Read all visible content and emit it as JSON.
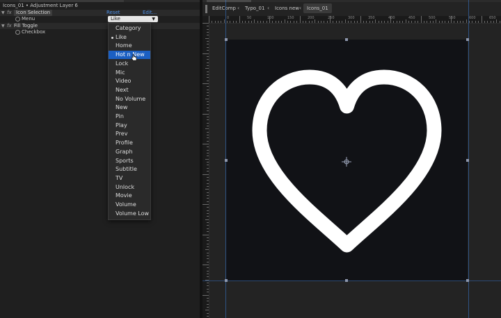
{
  "effect_panel": {
    "title": "Icons_01 • Adjustment Layer 6",
    "effects": [
      {
        "name": "Icon Selection",
        "reset": "Reset",
        "edit": "Edit...",
        "props": [
          {
            "label": "Menu",
            "value": "Like"
          }
        ]
      },
      {
        "name": "Fill Toggle",
        "props": [
          {
            "label": "Checkbox"
          }
        ]
      }
    ],
    "dropdown": {
      "items": [
        "Category",
        "Like",
        "Home",
        "Hot n New",
        "Lock",
        "Mic",
        "Video",
        "Next",
        "No Volume",
        "New",
        "Pin",
        "Play",
        "Prev",
        "Profile",
        "Graph",
        "Sports",
        "Subtitle",
        "TV",
        "Unlock",
        "Movie",
        "Volume",
        "Volume Low"
      ],
      "selected": "Like",
      "highlighted": "Hot n New"
    }
  },
  "viewer": {
    "breadcrumbs": [
      "EditComp",
      "Typo_01",
      "Icons new",
      "Icons_01"
    ],
    "active": "Icons_01",
    "ruler_labels": [
      "0",
      "50",
      "100",
      "150",
      "200",
      "250",
      "300",
      "350",
      "400",
      "450",
      "500",
      "550",
      "600",
      "650",
      "700"
    ]
  },
  "colors": {
    "accent": "#1b5fc2",
    "link": "#4d8fe6",
    "icon": "#ffffff",
    "comp_bg": "#111216"
  },
  "icons": {
    "dropdown_arrow": "chevron-down-icon",
    "stopwatch": "stopwatch-icon",
    "twirl": "triangle-down-icon",
    "canvas_icon": "heart-outline-icon",
    "anchor": "anchor-point-icon"
  }
}
